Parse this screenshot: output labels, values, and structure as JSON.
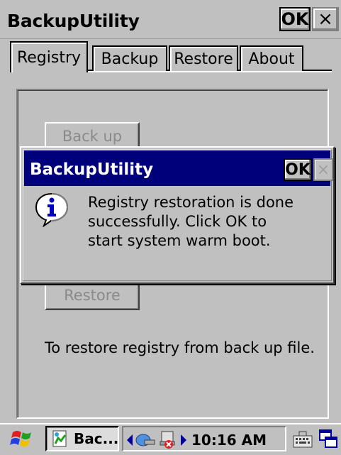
{
  "window": {
    "title": "BackupUtility",
    "ok_label": "OK",
    "close_label": "×"
  },
  "tabs": [
    {
      "label": "Registry",
      "active": true
    },
    {
      "label": "Backup",
      "active": false
    },
    {
      "label": "Restore",
      "active": false
    },
    {
      "label": "About",
      "active": false
    }
  ],
  "registry_tab": {
    "backup_button_label": "Back up",
    "restore_button_label": "Restore",
    "info_text": "To restore registry from back up file."
  },
  "dialog": {
    "title": "BackupUtility",
    "ok_label": "OK",
    "close_label": "×",
    "icon": "information-icon",
    "message_lines": [
      "Registry restoration is done",
      "successfully. Click OK to",
      "start system warm boot."
    ]
  },
  "taskbar": {
    "task_label": "Bac...",
    "time": "10:16 AM",
    "icons": [
      "start-flag-icon",
      "app-icon",
      "back-arrow-icon",
      "network-icon",
      "disconnected-icon",
      "forward-arrow-icon",
      "keyboard-icon",
      "windows-icon"
    ]
  },
  "colors": {
    "dialog_titlebar": "#00007b",
    "face": "#c0c0c0",
    "disabled_text": "#8a8a8a"
  }
}
